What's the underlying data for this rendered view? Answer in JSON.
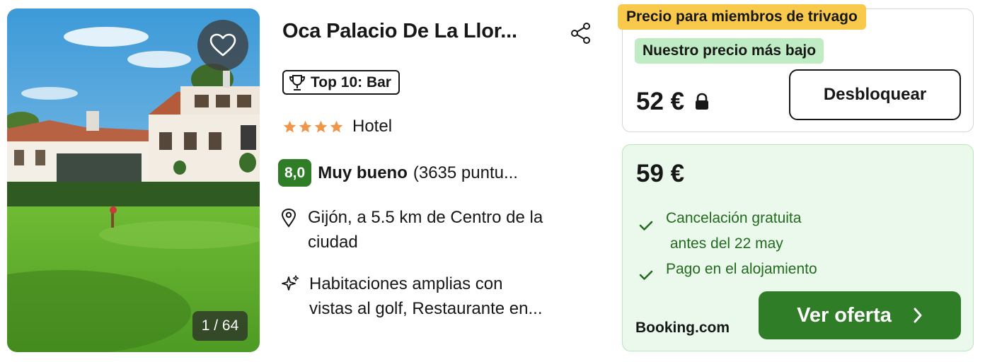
{
  "hotel": {
    "title": "Oca Palacio De La Llor...",
    "top_badge": "Top 10: Bar",
    "stars": 4,
    "type": "Hotel",
    "score": "8,0",
    "rating_label": "Muy bueno",
    "rating_count": "(3635 puntu...",
    "location_line1": "Gijón, a 5.5 km de Centro de la",
    "location_line2": "ciudad",
    "amenities_line1": "Habitaciones amplias con",
    "amenities_line2": "vistas al golf, Restaurante en..."
  },
  "gallery": {
    "counter": "1 / 64",
    "favorite_icon": "heart-icon"
  },
  "member_offer": {
    "tag": "Precio para miembros de trivago",
    "lowest_tag": "Nuestro precio más bajo",
    "price": "52 €",
    "button": "Desbloquear"
  },
  "offer": {
    "price": "59 €",
    "benefits": [
      "Cancelación gratuita",
      " antes del 22 may",
      "Pago en el alojamiento"
    ],
    "provider": "Booking.com",
    "button": "Ver oferta"
  },
  "colors": {
    "accent_green": "#2f7d27",
    "member_yellow": "#f8c94a",
    "lowest_green": "#bfecc2",
    "star_orange": "#f0964a"
  }
}
